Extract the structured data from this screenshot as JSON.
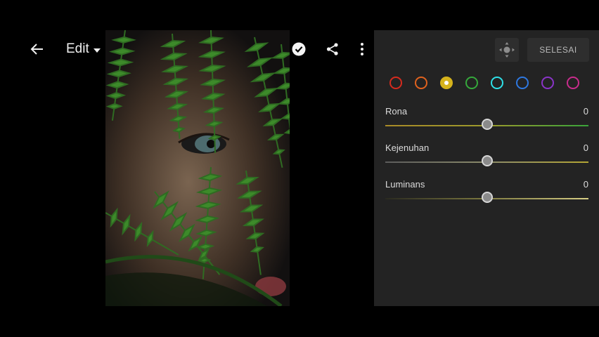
{
  "toolbar": {
    "menu_label": "Edit"
  },
  "panel": {
    "done_label": "SELESAI",
    "colors": [
      {
        "name": "red",
        "hex": "#d62b1e"
      },
      {
        "name": "orange",
        "hex": "#e0621e"
      },
      {
        "name": "yellow",
        "hex": "#d6b31c"
      },
      {
        "name": "green",
        "hex": "#35a83b"
      },
      {
        "name": "aqua",
        "hex": "#2ee0e8"
      },
      {
        "name": "blue",
        "hex": "#2e78e0"
      },
      {
        "name": "purple",
        "hex": "#8a34c8"
      },
      {
        "name": "magenta",
        "hex": "#c82c8c"
      }
    ],
    "selected_color": "yellow",
    "sliders": [
      {
        "label": "Rona",
        "value": "0",
        "level": 0.5
      },
      {
        "label": "Kejenuhan",
        "value": "0",
        "level": 0.5
      },
      {
        "label": "Luminans",
        "value": "0",
        "level": 0.5
      }
    ]
  }
}
